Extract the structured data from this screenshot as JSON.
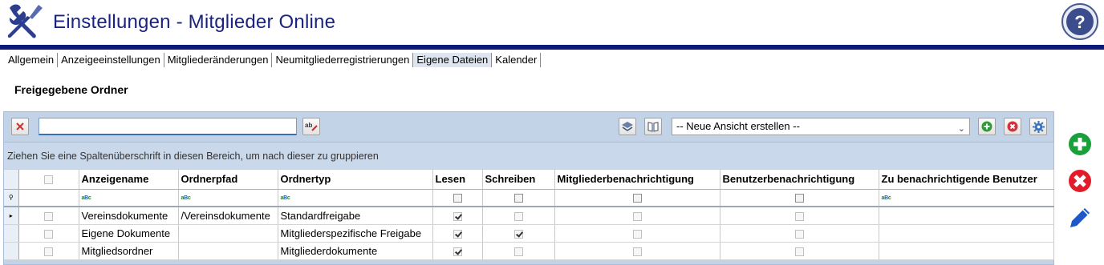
{
  "header": {
    "title": "Einstellungen - Mitglieder Online",
    "app_icon": "tools-icon",
    "help_icon": "help-icon",
    "accent_color": "#1a237e"
  },
  "tabs": [
    {
      "label": "Allgemein",
      "active": false
    },
    {
      "label": "Anzeigeeinstellungen",
      "active": false
    },
    {
      "label": "Mitgliederänderungen",
      "active": false
    },
    {
      "label": "Neumitgliederregistrierungen",
      "active": false
    },
    {
      "label": "Eigene Dateien",
      "active": true
    },
    {
      "label": "Kalender",
      "active": false
    }
  ],
  "section": {
    "title": "Freigegebene Ordner"
  },
  "toolbar": {
    "search_value": "",
    "view_select": "-- Neue Ansicht erstellen --"
  },
  "group_hint": "Ziehen Sie eine Spaltenüberschrift in diesen Bereich, um nach dieser zu gruppieren",
  "columns": [
    "Anzeigename",
    "Ordnerpfad",
    "Ordnertyp",
    "Lesen",
    "Schreiben",
    "Mitgliederbenachrichtigung",
    "Benutzerbenachrichtigung",
    "Zu benachrichtigende Benutzer"
  ],
  "rows": [
    {
      "anzeigename": "Vereinsdokumente",
      "ordnerpfad": "/Vereinsdokumente",
      "ordnertyp": "Standardfreigabe",
      "lesen": true,
      "schreiben": false,
      "mitgliederbenachrichtigung": false,
      "benutzerbenachrichtigung": false,
      "current": true
    },
    {
      "anzeigename": "Eigene Dokumente",
      "ordnerpfad": "",
      "ordnertyp": "Mitgliederspezifische Freigabe",
      "lesen": true,
      "schreiben": true,
      "mitgliederbenachrichtigung": false,
      "benutzerbenachrichtigung": false,
      "current": false
    },
    {
      "anzeigename": "Mitgliedsordner",
      "ordnerpfad": "",
      "ordnertyp": "Mitgliederdokumente",
      "lesen": true,
      "schreiben": false,
      "mitgliederbenachrichtigung": false,
      "benutzerbenachrichtigung": false,
      "current": false
    }
  ],
  "side_actions": [
    "add-icon",
    "delete-icon",
    "edit-icon"
  ]
}
